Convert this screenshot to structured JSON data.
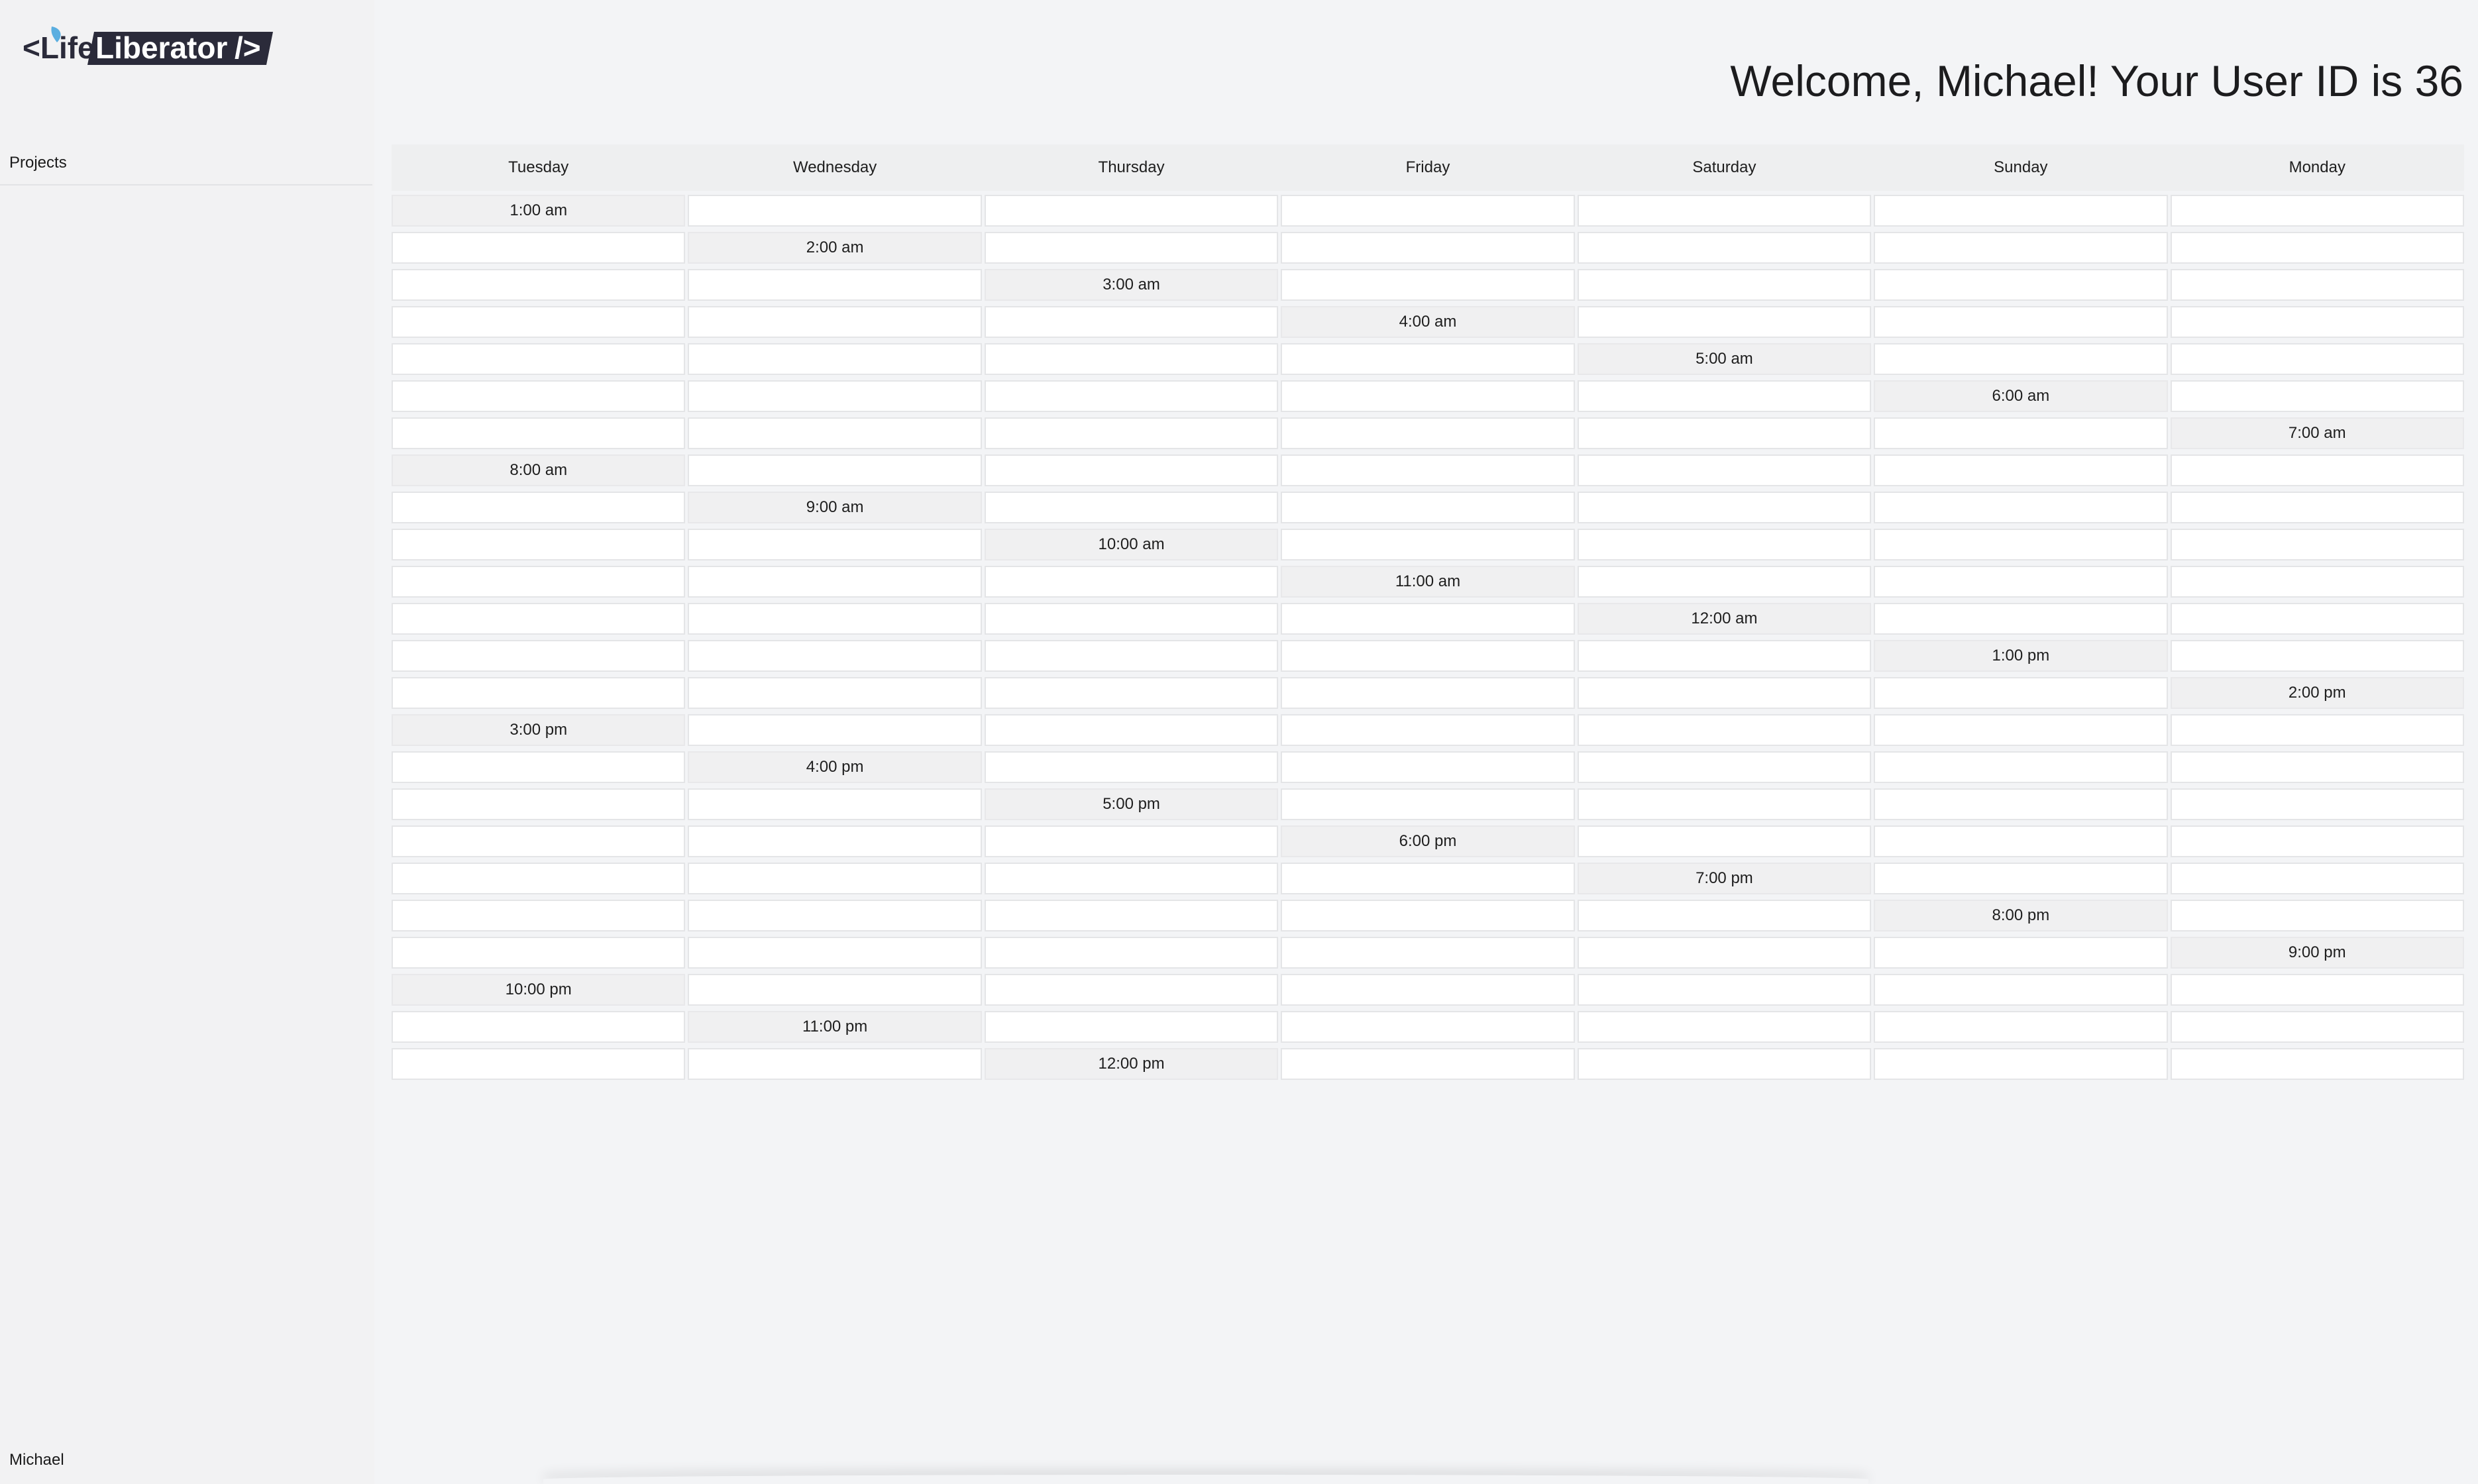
{
  "app": {
    "logo_text": "<Life Liberator />",
    "brand_color": "#2b2b3a",
    "leaf_color": "#5aaee0"
  },
  "sidebar": {
    "items": [
      {
        "label": "Projects"
      }
    ],
    "user_name": "Michael"
  },
  "header": {
    "welcome": "Welcome, Michael! Your User ID is 36"
  },
  "calendar": {
    "days": [
      "Tuesday",
      "Wednesday",
      "Thursday",
      "Friday",
      "Saturday",
      "Sunday",
      "Monday"
    ],
    "slots": [
      "1:00 am",
      "2:00 am",
      "3:00 am",
      "4:00 am",
      "5:00 am",
      "6:00 am",
      "7:00 am",
      "8:00 am",
      "9:00 am",
      "10:00 am",
      "11:00 am",
      "12:00 am",
      "1:00 pm",
      "2:00 pm",
      "3:00 pm",
      "4:00 pm",
      "5:00 pm",
      "6:00 pm",
      "7:00 pm",
      "8:00 pm",
      "9:00 pm",
      "10:00 pm",
      "11:00 pm",
      "12:00 pm"
    ]
  }
}
